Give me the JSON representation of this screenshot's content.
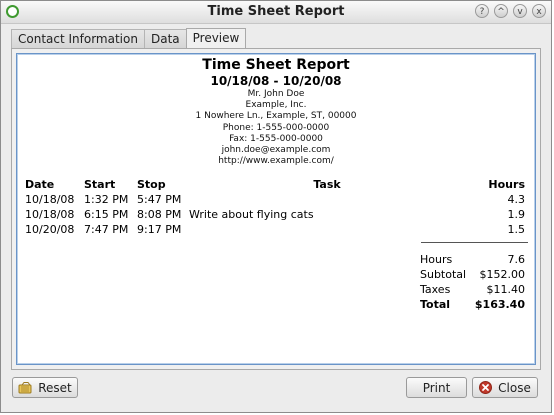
{
  "window": {
    "title": "Time Sheet Report",
    "controls": [
      "?",
      "^",
      "v",
      "x"
    ]
  },
  "tabs": [
    {
      "label": "Contact Information",
      "active": false
    },
    {
      "label": "Data",
      "active": false
    },
    {
      "label": "Preview",
      "active": true
    }
  ],
  "report": {
    "title": "Time Sheet Report",
    "date_range": "10/18/08 - 10/20/08",
    "contact": {
      "name": "Mr. John Doe",
      "company": "Example, Inc.",
      "address": "1 Nowhere Ln., Example, ST, 00000",
      "phone": "Phone: 1-555-000-0000",
      "fax": "Fax: 1-555-000-0000",
      "email": "john.doe@example.com",
      "website": "http://www.example.com/"
    },
    "columns": {
      "date": "Date",
      "start": "Start",
      "stop": "Stop",
      "task": "Task",
      "hours": "Hours"
    },
    "rows": [
      {
        "date": "10/18/08",
        "start": "1:32 PM",
        "stop": "5:47 PM",
        "task": "",
        "hours": "4.3"
      },
      {
        "date": "10/18/08",
        "start": "6:15 PM",
        "stop": "8:08 PM",
        "task": "Write about flying cats",
        "hours": "1.9"
      },
      {
        "date": "10/20/08",
        "start": "7:47 PM",
        "stop": "9:17 PM",
        "task": "",
        "hours": "1.5"
      }
    ],
    "summary": {
      "hours_label": "Hours",
      "hours_value": "7.6",
      "subtotal_label": "Subtotal",
      "subtotal_value": "$152.00",
      "taxes_label": "Taxes",
      "taxes_value": "$11.40",
      "total_label": "Total",
      "total_value": "$163.40"
    }
  },
  "buttons": {
    "reset": "Reset",
    "print": "Print",
    "close": "Close"
  },
  "colors": {
    "app_icon": "#3f9a30",
    "close_icon": "#c0392b",
    "preview_border": "#6a94c8"
  }
}
